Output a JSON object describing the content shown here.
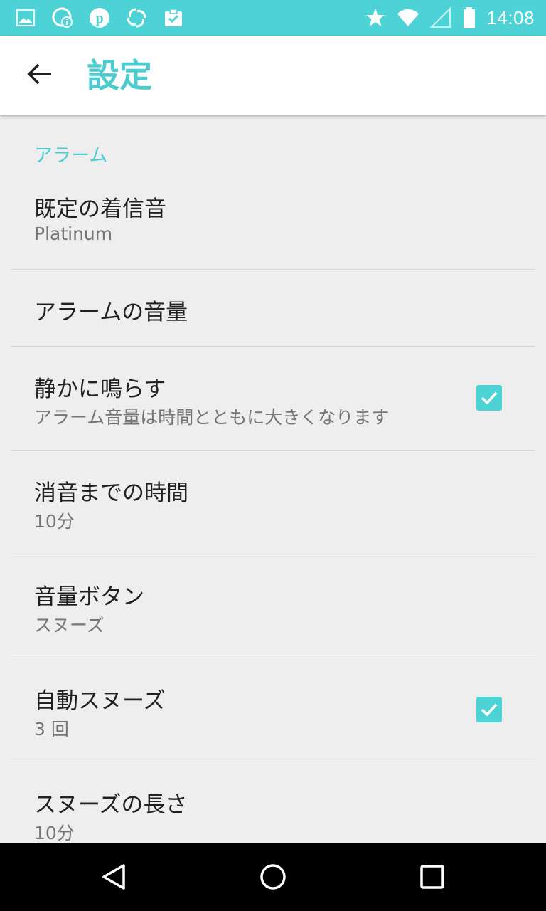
{
  "status_bar": {
    "time": "14:08",
    "left_icons": [
      "image-icon",
      "sync-info-icon",
      "pinterest-icon",
      "swirl-app-icon",
      "task-check-icon"
    ],
    "right_icons": [
      "star-icon",
      "wifi-icon",
      "signal-icon",
      "battery-icon"
    ]
  },
  "app_bar": {
    "title": "設定",
    "back_icon": "arrow-back-icon"
  },
  "settings": {
    "section_title": "アラーム",
    "items": [
      {
        "title": "既定の着信音",
        "summary": "Platinum"
      },
      {
        "title": "アラームの音量",
        "summary": ""
      },
      {
        "title": "静かに鳴らす",
        "summary": "アラーム音量は時間とともに大きくなります",
        "checked": true
      },
      {
        "title": "消音までの時間",
        "summary": "10分"
      },
      {
        "title": "音量ボタン",
        "summary": "スヌーズ"
      },
      {
        "title": "自動スヌーズ",
        "summary": "3 回",
        "checked": true
      },
      {
        "title": "スヌーズの長さ",
        "summary": "10分"
      }
    ]
  },
  "nav_bar": {
    "icons": [
      "back-triangle-icon",
      "home-circle-icon",
      "recents-square-icon"
    ]
  },
  "colors": {
    "accent": "#4dd2d6",
    "title_accent": "#4ccccf",
    "background": "#eeeeee",
    "primary_text": "#212121",
    "secondary_text": "#757575"
  }
}
